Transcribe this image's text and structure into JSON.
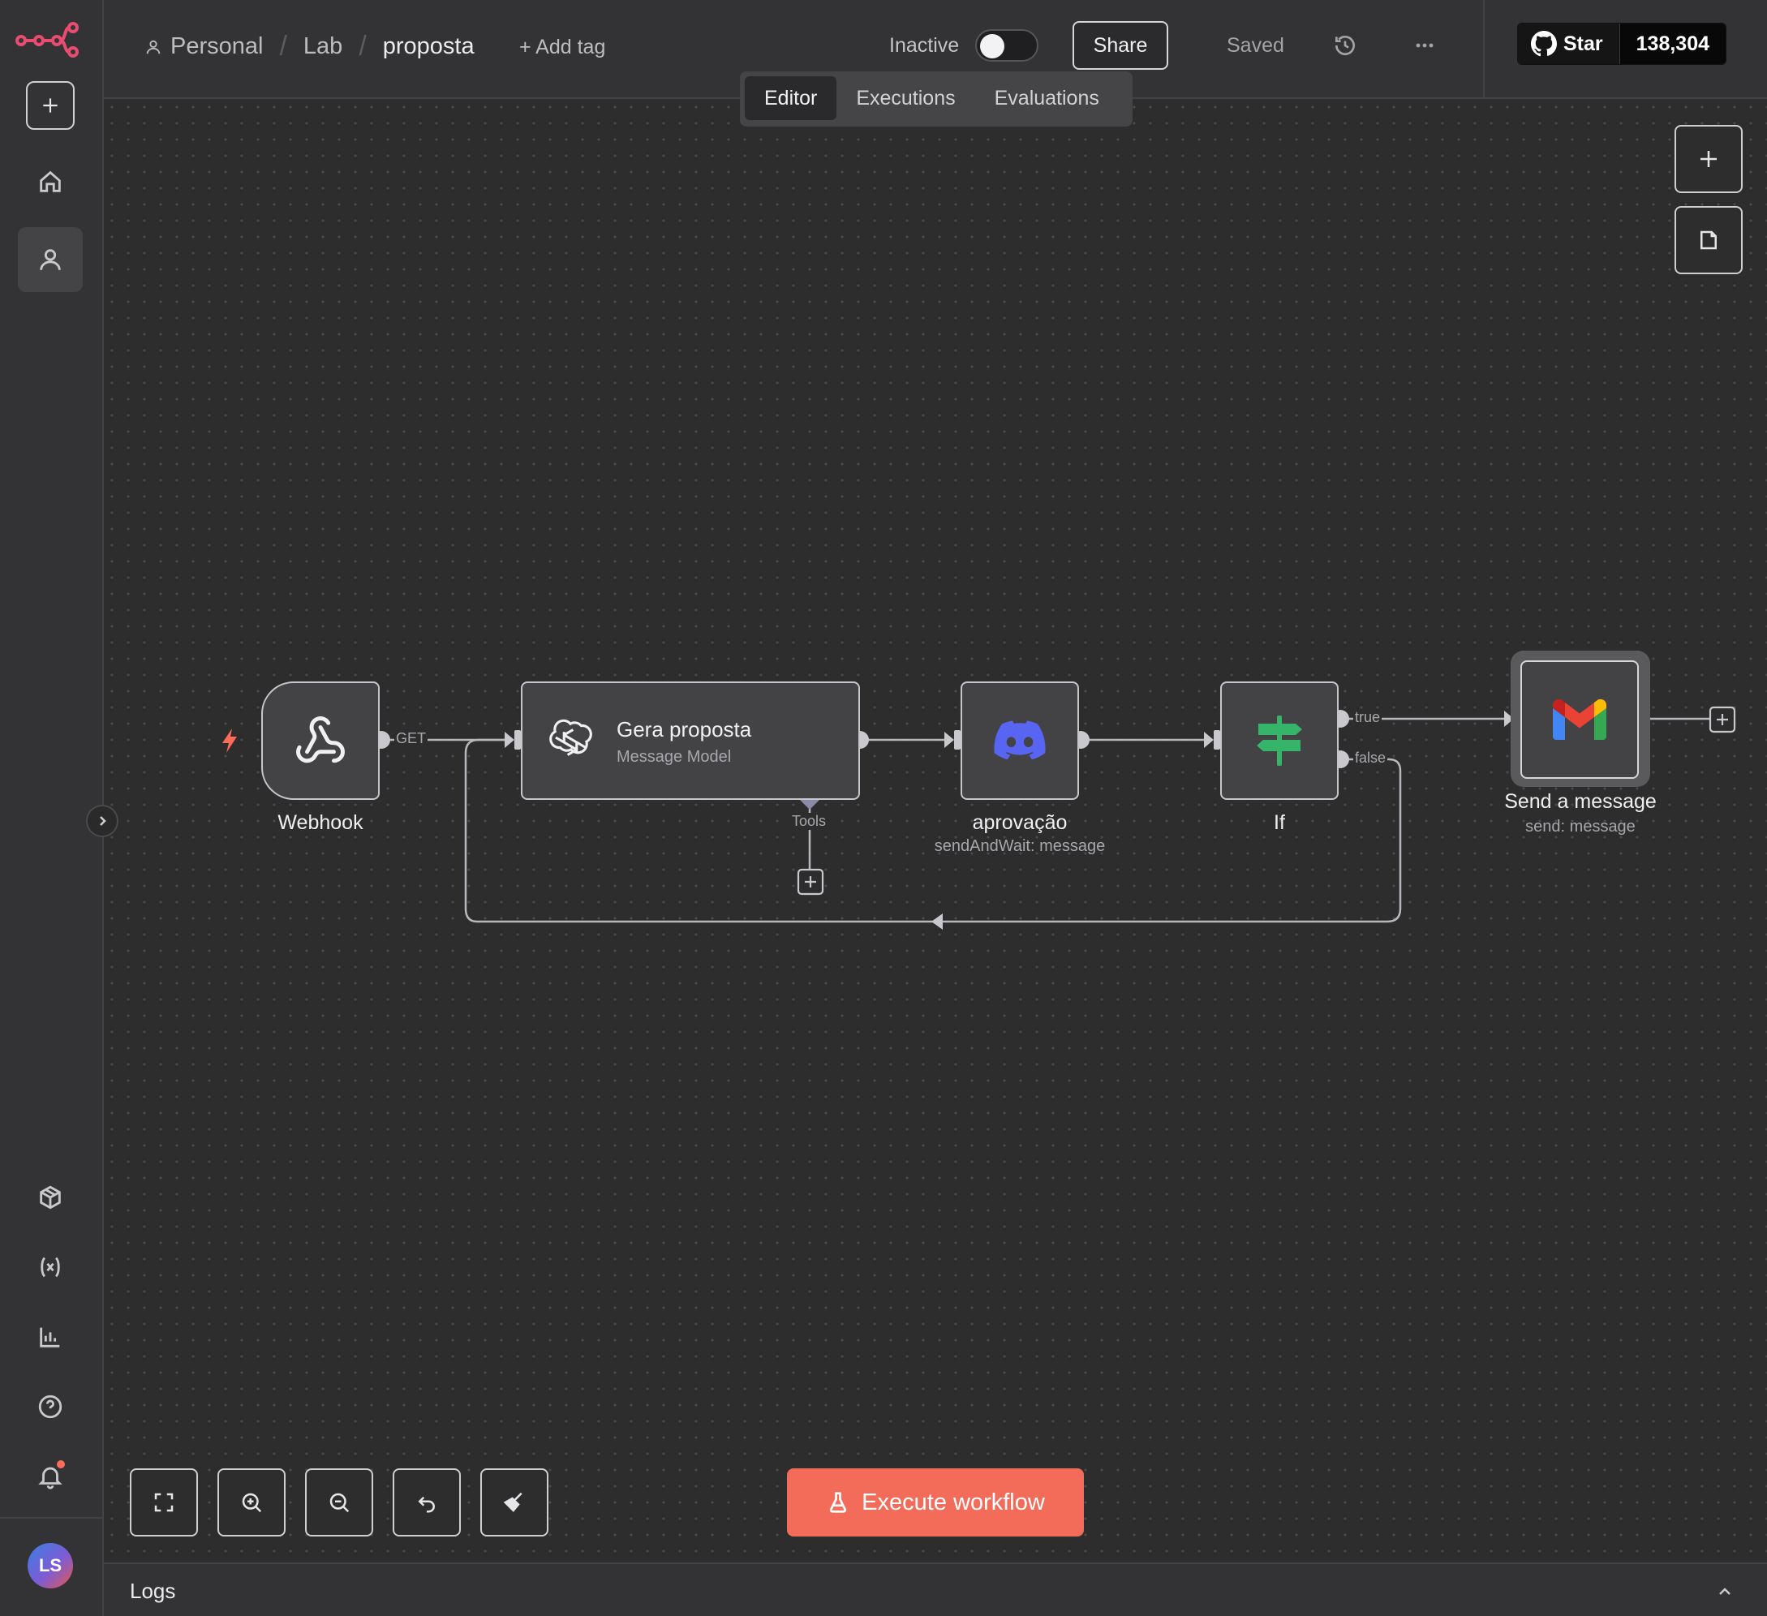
{
  "breadcrumb": {
    "owner": "Personal",
    "folder": "Lab",
    "workflow": "proposta"
  },
  "header": {
    "add_tag": "+ Add tag",
    "status": "Inactive",
    "share": "Share",
    "saved": "Saved",
    "active": false
  },
  "github": {
    "star": "Star",
    "count": "138,304"
  },
  "tabs": [
    {
      "label": "Editor",
      "active": true
    },
    {
      "label": "Executions",
      "active": false
    },
    {
      "label": "Evaluations",
      "active": false
    }
  ],
  "nodes": {
    "webhook": {
      "name": "Webhook",
      "icon": "webhook-icon"
    },
    "gera": {
      "name": "Gera proposta",
      "subtitle": "Message Model",
      "icon": "openai-icon"
    },
    "aprovacao": {
      "name": "aprovação",
      "subtitle": "sendAndWait: message",
      "icon": "discord-icon"
    },
    "if": {
      "name": "If",
      "icon": "signpost-icon"
    },
    "gmail": {
      "name": "Send a message",
      "subtitle": "send: message",
      "icon": "gmail-icon"
    }
  },
  "edges": {
    "webhook_output": "GET",
    "tools": "Tools",
    "if_true": "true",
    "if_false": "false"
  },
  "execute_button": "Execute workflow",
  "logs": {
    "label": "Logs"
  },
  "user": {
    "initials": "LS"
  },
  "colors": {
    "accent": "#ff6d5a",
    "canvas": "#2d2d2e",
    "discord": "#5865f2",
    "if_green": "#35b46a"
  }
}
